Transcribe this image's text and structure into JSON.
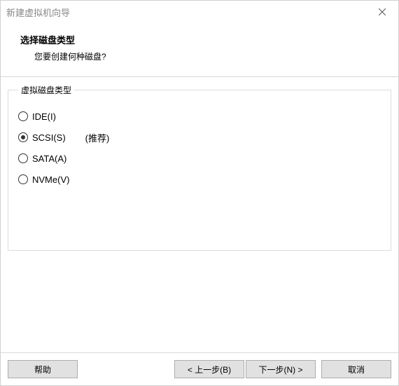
{
  "window": {
    "title": "新建虚拟机向导"
  },
  "header": {
    "title": "选择磁盘类型",
    "subtitle": "您要创建何种磁盘?"
  },
  "fieldset": {
    "legend": "虚拟磁盘类型"
  },
  "options": {
    "ide": {
      "label": "IDE(I)",
      "selected": false
    },
    "scsi": {
      "label": "SCSI(S)",
      "selected": true,
      "note": "(推荐)"
    },
    "sata": {
      "label": "SATA(A)",
      "selected": false
    },
    "nvme": {
      "label": "NVMe(V)",
      "selected": false
    }
  },
  "buttons": {
    "help": "帮助",
    "back": "< 上一步(B)",
    "next": "下一步(N) >",
    "cancel": "取消"
  }
}
